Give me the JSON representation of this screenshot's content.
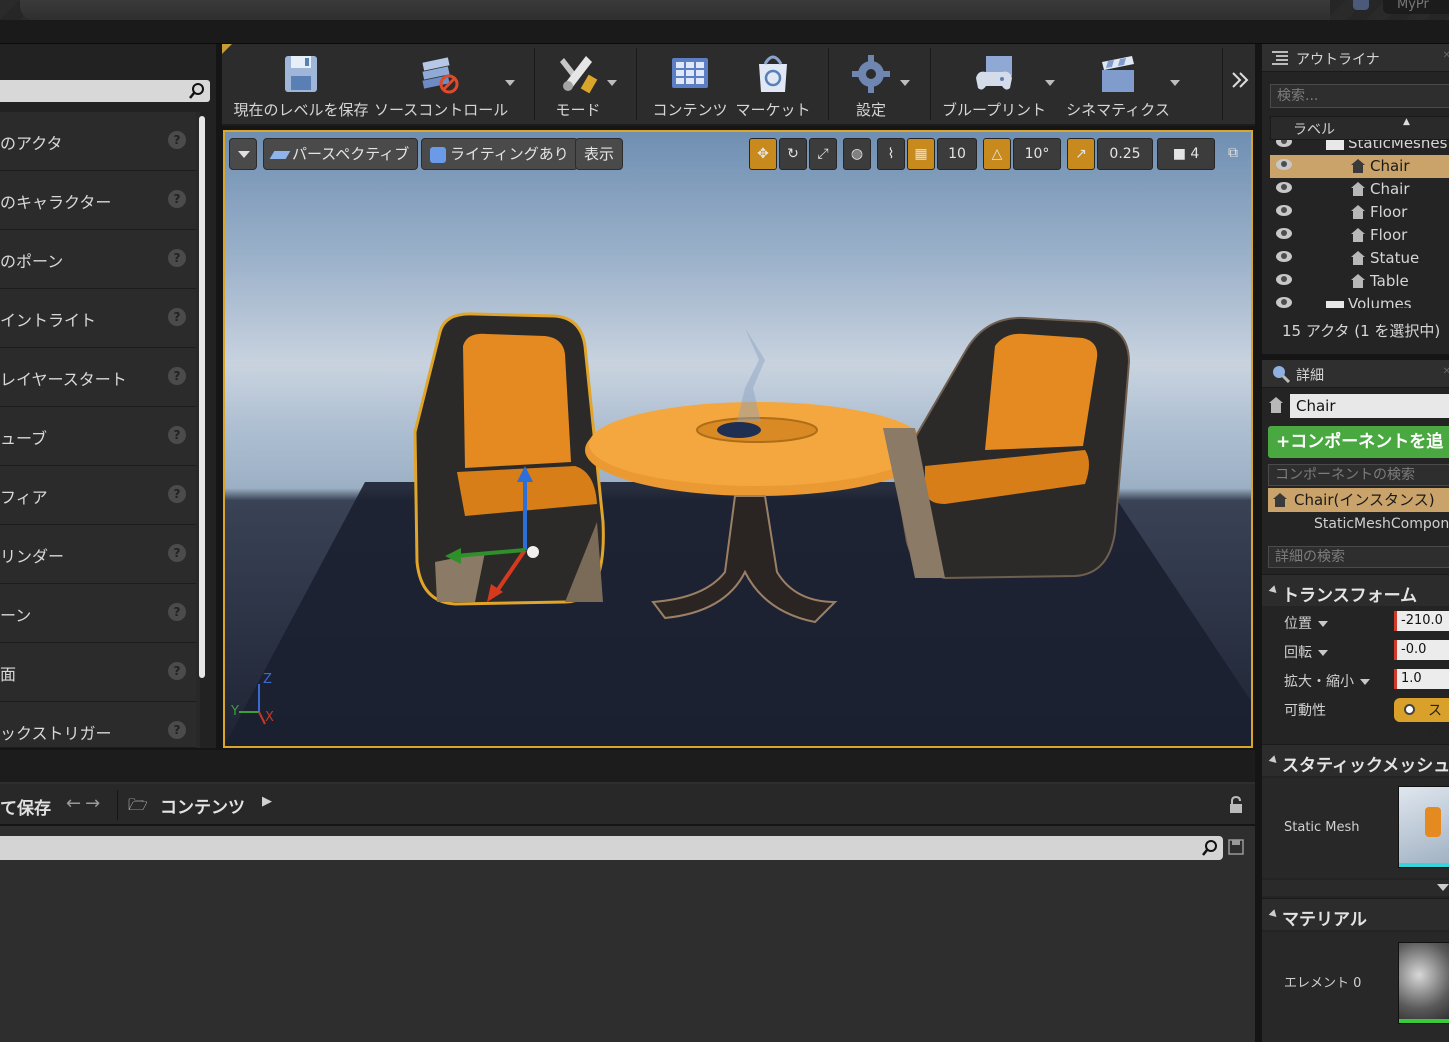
{
  "title_bar": {
    "project_name": "MyPr"
  },
  "place_panel": {
    "items": [
      "のアクタ",
      "のキャラクター",
      "のポーン",
      "イントライト",
      "レイヤースタート",
      "ューブ",
      "フィア",
      "リンダー",
      "ーン",
      "面",
      "ックストリガー"
    ]
  },
  "toolbar": {
    "save_level": "現在のレベルを保存",
    "source_control": "ソースコントロール",
    "modes": "モード",
    "content": "コンテンツ",
    "marketplace": "マーケット",
    "settings": "設定",
    "blueprints": "ブループリント",
    "cinematics": "シネマティクス"
  },
  "viewport": {
    "perspective": "パースペクティブ",
    "lighting": "ライティングあり",
    "show": "表示",
    "grid_snap": "10",
    "rotation_snap": "10°",
    "scale_snap": "0.25",
    "camera_speed": "4",
    "axis_z": "Z",
    "axis_x": "X",
    "axis_y": "Y"
  },
  "content_browser": {
    "save_all": "て保存",
    "path_root": "コンテンツ"
  },
  "outliner": {
    "tab_title": "アウトライナ",
    "search_placeholder": "検索...",
    "column_label": "ラベル",
    "rows": [
      {
        "name": "StaticMeshes",
        "kind": "folder",
        "selected": false
      },
      {
        "name": "Chair",
        "kind": "actor",
        "selected": true
      },
      {
        "name": "Chair",
        "kind": "actor",
        "selected": false
      },
      {
        "name": "Floor",
        "kind": "actor",
        "selected": false
      },
      {
        "name": "Floor",
        "kind": "actor",
        "selected": false
      },
      {
        "name": "Statue",
        "kind": "actor",
        "selected": false
      },
      {
        "name": "Table",
        "kind": "actor",
        "selected": false
      },
      {
        "name": "Volumes",
        "kind": "folder",
        "selected": false
      }
    ],
    "actor_count": "15 アクタ (1 を選択中)"
  },
  "details": {
    "tab_title": "詳細",
    "actor_name": "Chair",
    "add_component": "+コンポーネントを追",
    "component_search_placeholder": "コンポーネントの検索",
    "component_instance": "Chair(インスタンス)",
    "component_static_mesh": "StaticMeshCompon",
    "details_search_placeholder": "詳細の検索",
    "transform_header": "トランスフォーム",
    "location_label": "位置",
    "location_value": "-210.0",
    "rotation_label": "回転",
    "rotation_value": "-0.0",
    "scale_label": "拡大・縮小",
    "scale_value": "1.0",
    "mobility_label": "可動性",
    "mobility_value": "スタ",
    "static_mesh_header": "スタティックメッシュ",
    "static_mesh_label": "Static Mesh",
    "materials_header": "マテリアル",
    "element_label": "エレメント 0"
  },
  "colors": {
    "accent_orange": "#d9a52a",
    "selection": "#c9a36a",
    "add_green": "#4aa841",
    "panel_dark": "#242424"
  }
}
